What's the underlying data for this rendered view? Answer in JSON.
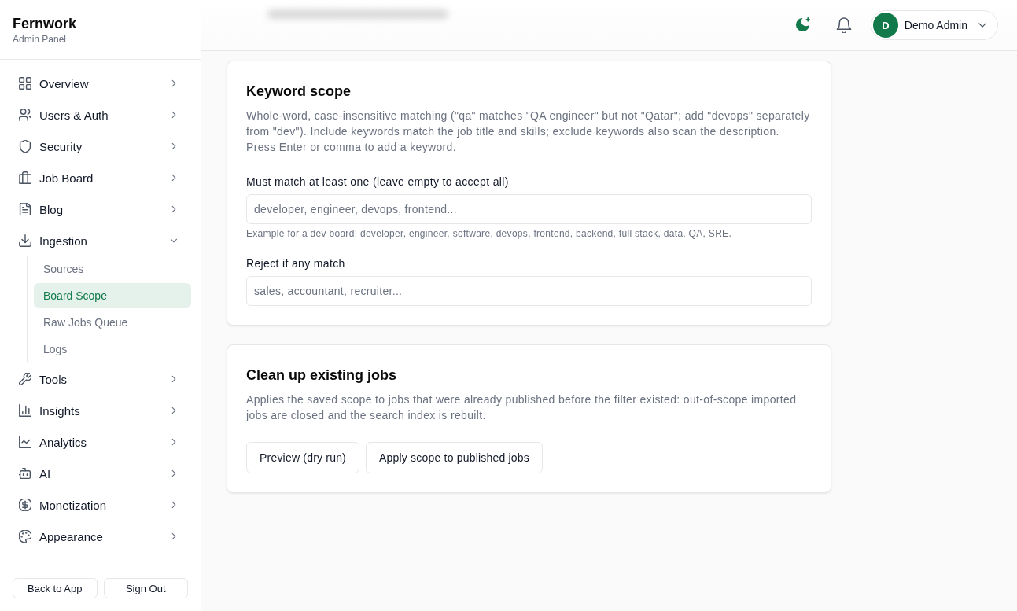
{
  "sidebar": {
    "brand": "Fernwork",
    "subtitle": "Admin Panel",
    "nav": [
      {
        "label": "Overview",
        "expanded": false
      },
      {
        "label": "Users & Auth",
        "expanded": false
      },
      {
        "label": "Security",
        "expanded": false
      },
      {
        "label": "Job Board",
        "expanded": false
      },
      {
        "label": "Blog",
        "expanded": false
      },
      {
        "label": "Ingestion",
        "expanded": true,
        "children": [
          {
            "label": "Sources",
            "selected": false
          },
          {
            "label": "Board Scope",
            "selected": true
          },
          {
            "label": "Raw Jobs Queue",
            "selected": false
          },
          {
            "label": "Logs",
            "selected": false
          }
        ]
      },
      {
        "label": "Tools",
        "expanded": false
      },
      {
        "label": "Insights",
        "expanded": false
      },
      {
        "label": "Analytics",
        "expanded": false
      },
      {
        "label": "AI",
        "expanded": false
      },
      {
        "label": "Monetization",
        "expanded": false
      },
      {
        "label": "Appearance",
        "expanded": false
      }
    ],
    "footer_buttons": [
      "Back to App",
      "Sign Out"
    ]
  },
  "header": {
    "user": {
      "initial": "D",
      "name": "Demo Admin"
    }
  },
  "cards": [
    {
      "title": "Keyword scope",
      "description": "Whole-word, case-insensitive matching (\"qa\" matches \"QA engineer\" but not \"Qatar\"; add \"devops\" separately from \"dev\"). Include keywords match the job title and skills; exclude keywords also scan the description. Press Enter or comma to add a keyword.",
      "fields": [
        {
          "label": "Must match at least one (leave empty to accept all)",
          "placeholder": "developer, engineer, devops, frontend...",
          "hint": "Example for a dev board: developer, engineer, software, devops, frontend, backend, full stack, data, QA, SRE."
        },
        {
          "label": "Reject if any match",
          "placeholder": "sales, accountant, recruiter..."
        }
      ]
    },
    {
      "title": "Clean up existing jobs",
      "description": "Applies the saved scope to jobs that were already published before the filter existed: out-of-scope imported jobs are closed and the search index is rebuilt.",
      "buttons": [
        "Preview (dry run)",
        "Apply scope to published jobs"
      ]
    }
  ]
}
